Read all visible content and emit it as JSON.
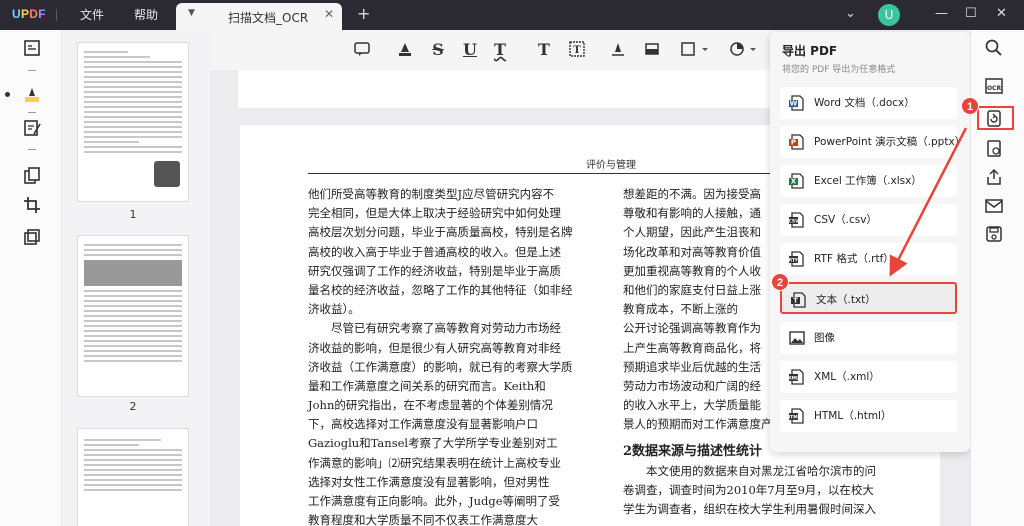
{
  "app": {
    "logo": "UPDF",
    "menu": [
      "文件",
      "帮助"
    ],
    "tab_title": "扫描文档_OCR",
    "avatar_letter": "U"
  },
  "thumbnails": [
    {
      "page": "1"
    },
    {
      "page": "2"
    }
  ],
  "document": {
    "running_head": "评价与管理",
    "left_column": [
      "他们所受高等教育的制度类型J应尽管研究内容不",
      "完全相同，但是大体上取决于经验研究中如何处理",
      "高校层次划分问题，毕业于高质量高校，特别是名牌",
      "高校的收入高于毕业于普通高校的收入。但是上述",
      "研究仅强调了工作的经济收益，特别是毕业于高质",
      "量名校的经济收益，忽略了工作的其他特征（如非经",
      "济收益）。",
      "　　尽管已有研究考察了高等教育对劳动力市场经",
      "济收益的影响，但是很少有人研究高等教育对非经",
      "济收益（工作满意度）的影响，就已有的考察大学质",
      "量和工作满意度之间关系的研究而言。Keith和",
      "John的研究指出，在不考虑显著的个体差别情况",
      "下，高校选择对工作满意度没有显著影响户口",
      "Gazioglu和Tansel考察了大学所学专业差别对工",
      "作满意的影响」⑵研究结果表明在统计上高校专业",
      "选择对女性工作满意度没有显著影响，但对男性",
      "工作满意度有正向影响。此外，Judge等阐明了受",
      "教育程度和大学质量不同不仅表工作满意度大"
    ],
    "right_column": [
      "想差距的不满。因为接受高",
      "尊敬和有影响的人接触，通",
      "个人期望，因此产生沮丧和",
      "场化改革和对高等教育价值",
      "更加重视高等教育的个人收",
      "和他们的家庭支付日益上涨",
      "教育成本，不断上涨的",
      "公开讨论强调高等教育作为",
      "上产生高等教育商品化，将",
      "预期追求毕业后优越的生活",
      "劳动力市场波动和广阔的经",
      "的收入水平上，大学质量能",
      "景人的预期而对工作满意度产生"
    ],
    "section_heading": "2数据来源与描述性统计",
    "section_lines": [
      "　　本文使用的数据来自对黑龙江省哈尔滨市的问",
      "卷调查，调查时间为2010年7月至9月，以在校大",
      "学生为调查者，组织在校大学生利用暑假时间深入"
    ]
  },
  "export_panel": {
    "title": "导出 PDF",
    "subtitle": "将您的 PDF 导出为任意格式",
    "items": [
      {
        "label": "Word 文档（.docx）",
        "icon": "word-icon",
        "color": "#2b579a"
      },
      {
        "label": "PowerPoint 演示文稿（.pptx）",
        "icon": "powerpoint-icon",
        "color": "#c43e1c"
      },
      {
        "label": "Excel 工作簿（.xlsx）",
        "icon": "excel-icon",
        "color": "#217346"
      },
      {
        "label": "CSV（.csv）",
        "icon": "csv-icon",
        "color": "#333333"
      },
      {
        "label": "RTF 格式（.rtf）",
        "icon": "rtf-icon",
        "color": "#333333"
      },
      {
        "label": "文本（.txt）",
        "icon": "txt-icon",
        "color": "#333333",
        "selected": true
      },
      {
        "label": "图像",
        "icon": "image-icon",
        "color": "#333333"
      },
      {
        "label": "XML（.xml）",
        "icon": "xml-icon",
        "color": "#333333"
      },
      {
        "label": "HTML（.html）",
        "icon": "html-icon",
        "color": "#333333"
      }
    ]
  },
  "annotations": {
    "badge_1": "1",
    "badge_2": "2",
    "color": "#e8443a"
  }
}
